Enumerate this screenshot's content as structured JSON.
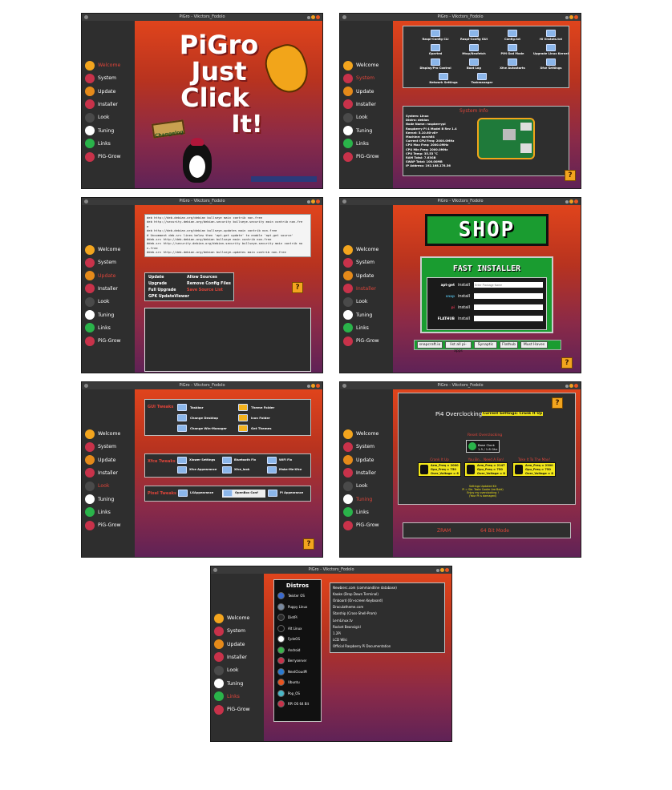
{
  "app_title": "PiGro - Vikctors_Fodolo",
  "nav": [
    "Welcome",
    "System",
    "Update",
    "Installer",
    "Look",
    "Tuning",
    "Links",
    "PiG-Grow"
  ],
  "nav_icon_names": [
    "pi-icon",
    "system-icon",
    "update-icon",
    "installer-icon",
    "look-icon",
    "tuning-icon",
    "links-icon",
    "pigrow-icon"
  ],
  "help_label": "?",
  "colors": {
    "accent": "#e95420",
    "active_nav": "#e0453a",
    "sidebar": "#2e2e2e",
    "gradient_top": "#e0441c",
    "gradient_bottom": "#5e2257"
  },
  "welcome": {
    "title_lines": [
      "PiGro",
      "Just",
      "Click",
      "It!"
    ],
    "sign_label": "Changelog"
  },
  "system": {
    "tools": [
      "Raspi-Config CLI",
      "Raspi-Config GUI",
      "Config.txt",
      "Hi Vnstats.txt",
      "Gparted",
      "Htop/Neofetch",
      "PiM God Mode",
      "Upgrade Linux Kernel",
      "Display/Pro Control",
      "Boot Log",
      "Xfce Autostarts",
      "Xfce Settings",
      "Network Settings",
      "Taskmanager"
    ],
    "info_title": "System Info",
    "info_lines": [
      "System: Linux",
      "Distro: debian",
      "Node Name: raspberrypi",
      "Raspberry Pi 4 Model B Rev 1.4",
      "Kernel: 5.10.60-v8+",
      "Machine: aarch64",
      "Current CPU Freq: 2000.0MHz",
      "CPU Max Freq: 2000.0MHz",
      "CPU Min Freq: 2000.0MHz",
      "CPU Temp: 35.53 °C",
      "RAM Total: 7.63GB",
      "SWAP Total: 100.00MB",
      "IP Address: 192.168.178.56"
    ]
  },
  "update": {
    "sources": [
      "deb http://deb.debian.org/debian bullseye main contrib non-free",
      "deb http://security.debian.org/debian-security bullseye-security main contrib non-fre",
      "e",
      "deb http://deb.debian.org/debian bullseye-updates main contrib non-free",
      "# Uncomment deb-src lines below then 'apt-get update' to enable 'apt-get source'",
      "#deb-src http://deb.debian.org/debian bullseye main contrib non-free",
      "#deb-src http://security.debian.org/debian-security bullseye-security main contrib no",
      "n-free",
      "#deb-src http://deb.debian.org/debian bullseye-updates main contrib non-free"
    ],
    "left_buttons": [
      "Update",
      "Upgrade",
      "Full Upgrade",
      "GPK UpdateViewer"
    ],
    "right_buttons": [
      "Allow Sources",
      "Remove Config Files",
      "Save Source List"
    ]
  },
  "installer": {
    "shop_title": "SHOP",
    "fast_title": "FAST INSTALLER",
    "rows": [
      {
        "brand": "apt-get",
        "button": "install",
        "placeholder": "Enter Package Name"
      },
      {
        "brand": "snap",
        "button": "install",
        "placeholder": ""
      },
      {
        "brand": "pi",
        "button": "install",
        "placeholder": ""
      },
      {
        "brand": "FLATHUB",
        "button": "install",
        "placeholder": ""
      }
    ],
    "bottom_buttons": [
      "snapcraft.io",
      "list all pi-apps",
      "Synaptic",
      "Flathub",
      "Must Haves"
    ]
  },
  "look": {
    "gui_title": "GUI Tweaks",
    "gui_items": [
      "Taskbar",
      "Theme Folder",
      "Change Desktop",
      "Icon Folder",
      "Change Win-Manager",
      "Get Themes"
    ],
    "xfce_title": "Xfce Tweaks",
    "xfce_items": [
      "Xlower Settings",
      "Bluetooth Fix",
      "WiFi Fix",
      "Xfce Appearance",
      "Xfce_look",
      "Make-Me-Xfce"
    ],
    "pixel_title": "Pixel Tweaks",
    "pixel_items": [
      "LXAppearance",
      "OpenBox Conf",
      "Pi Appearance"
    ]
  },
  "tuning": {
    "title": "Pi4 Overclocking",
    "current": "Current Settings: Crank It Up",
    "reset_title": "Reset Overclocking",
    "base_label": "Base Clock",
    "base_sub": "1.5 / 1.8 Ghz",
    "presets": [
      {
        "title": "Crank It Up",
        "lines": [
          "Arm_Freq = 2000",
          "Gpu_Freq = 750",
          "Over_Voltage = 6"
        ]
      },
      {
        "title": "You Bn... Need A Fan!",
        "lines": [
          "Arm_Freq = 2147",
          "Gpu_Freq = 750",
          "Over_Voltage = 8"
        ]
      },
      {
        "title": "Take It To The Max!",
        "lines": [
          "Arm_Freq = 2300",
          "Gpu_Freq = 750",
          "Over_Voltage = 8"
        ]
      }
    ],
    "warning": [
      "Settings Updated Kit",
      "Pi = Sie. Taste Cooler Are Bold)",
      "Enjoy my overclocking !",
      "(Your Pi is damaged)"
    ],
    "zram": "ZRAM",
    "mode": "64 Bit Mode"
  },
  "links": {
    "distros_title": "Distros",
    "distros": [
      "Twister OS",
      "Puppy Linux",
      "DietPi",
      "Alt Linux",
      "FydeOS",
      "Android",
      "Berryserver",
      "NextCloudPi",
      "Ubuntu",
      "Pop_OS",
      "RPi OS 64 Bit"
    ],
    "links": [
      "Newbierc.com (commandline database)",
      "Kaake (Drop Down Terminal)",
      "Onboard (On-screen Keyboard)",
      "Draculatheme.com",
      "Starship (Cross-Shell-Prom)",
      "LernLinux.tv",
      "Rocket Beansigir.l",
      "1.2Pi",
      "LCD Wiki",
      "Official Raspberry Pi Documentation"
    ]
  }
}
